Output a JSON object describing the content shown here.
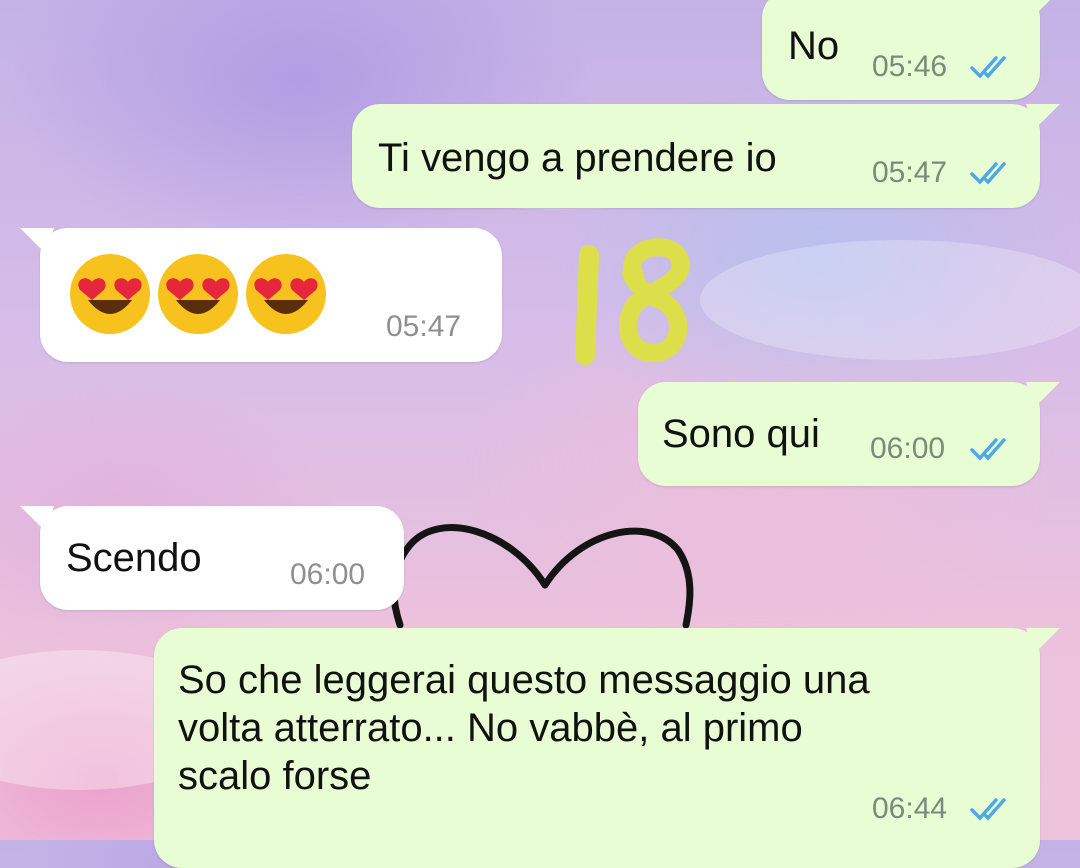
{
  "messages": [
    {
      "direction": "outgoing",
      "text": "No",
      "time": "05:46",
      "status": "read-double-tick"
    },
    {
      "direction": "outgoing",
      "text": "Ti vengo a prendere io",
      "time": "05:47",
      "status": "read-double-tick"
    },
    {
      "direction": "incoming",
      "emojis": [
        "smiling-face-with-heart-eyes",
        "smiling-face-with-heart-eyes",
        "smiling-face-with-heart-eyes"
      ],
      "time": "05:47"
    },
    {
      "direction": "outgoing",
      "text": "Sono qui",
      "time": "06:00",
      "status": "read-double-tick"
    },
    {
      "direction": "incoming",
      "text": "Scendo",
      "time": "06:00"
    },
    {
      "direction": "outgoing",
      "text": "So che leggerai questo messaggio una\nvolta atterrato... No vabbè, al primo\nscalo forse",
      "time": "06:44",
      "status": "read-double-tick"
    }
  ],
  "overlay": {
    "label": "18",
    "color": "#dcdf4a"
  },
  "colors": {
    "outgoing_bubble": "#e8fdd4",
    "incoming_bubble": "#ffffff",
    "read_tick": "#4fa8e6"
  },
  "icons": {
    "read_receipt": "double-check-icon",
    "emoji": "heart-eyes-emoji-icon",
    "wallpaper": "heart-outline-icon"
  }
}
